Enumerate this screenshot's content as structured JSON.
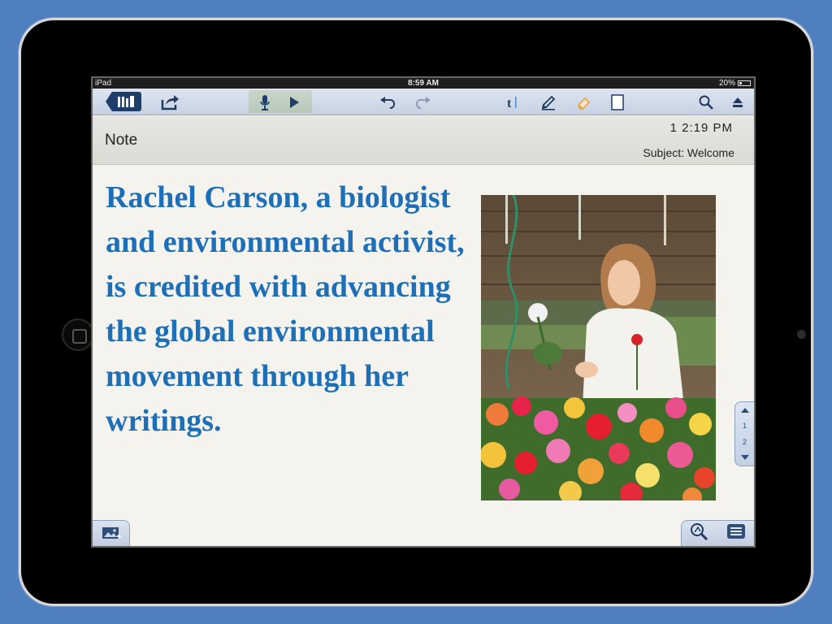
{
  "statusbar": {
    "device": "iPad",
    "time": "8:59 AM",
    "battery": "20%"
  },
  "toolbar": {
    "back_icon": "notebooks-icon",
    "share_icon": "share-icon",
    "mic_icon": "microphone-icon",
    "play_icon": "play-icon",
    "undo_icon": "undo-icon",
    "redo_icon": "redo-icon",
    "text_icon": "text-tool-icon",
    "pen_icon": "pen-icon",
    "eraser_icon": "eraser-icon",
    "page_icon": "page-icon",
    "search_icon": "search-icon",
    "eject_icon": "hide-keyboard-icon"
  },
  "note": {
    "title": "Note",
    "time": "1 2:19 PM",
    "subject": "Subject: Welcome",
    "body": "Rachel Carson, a biologist and environmental activist, is credited with advancing the global environmental movement through her writings."
  },
  "pager": {
    "top": "1",
    "bottom": "2"
  },
  "colors": {
    "body_text": "#1d70b8",
    "toolbar": "#c6d1e2",
    "background": "#4f7fbf"
  }
}
